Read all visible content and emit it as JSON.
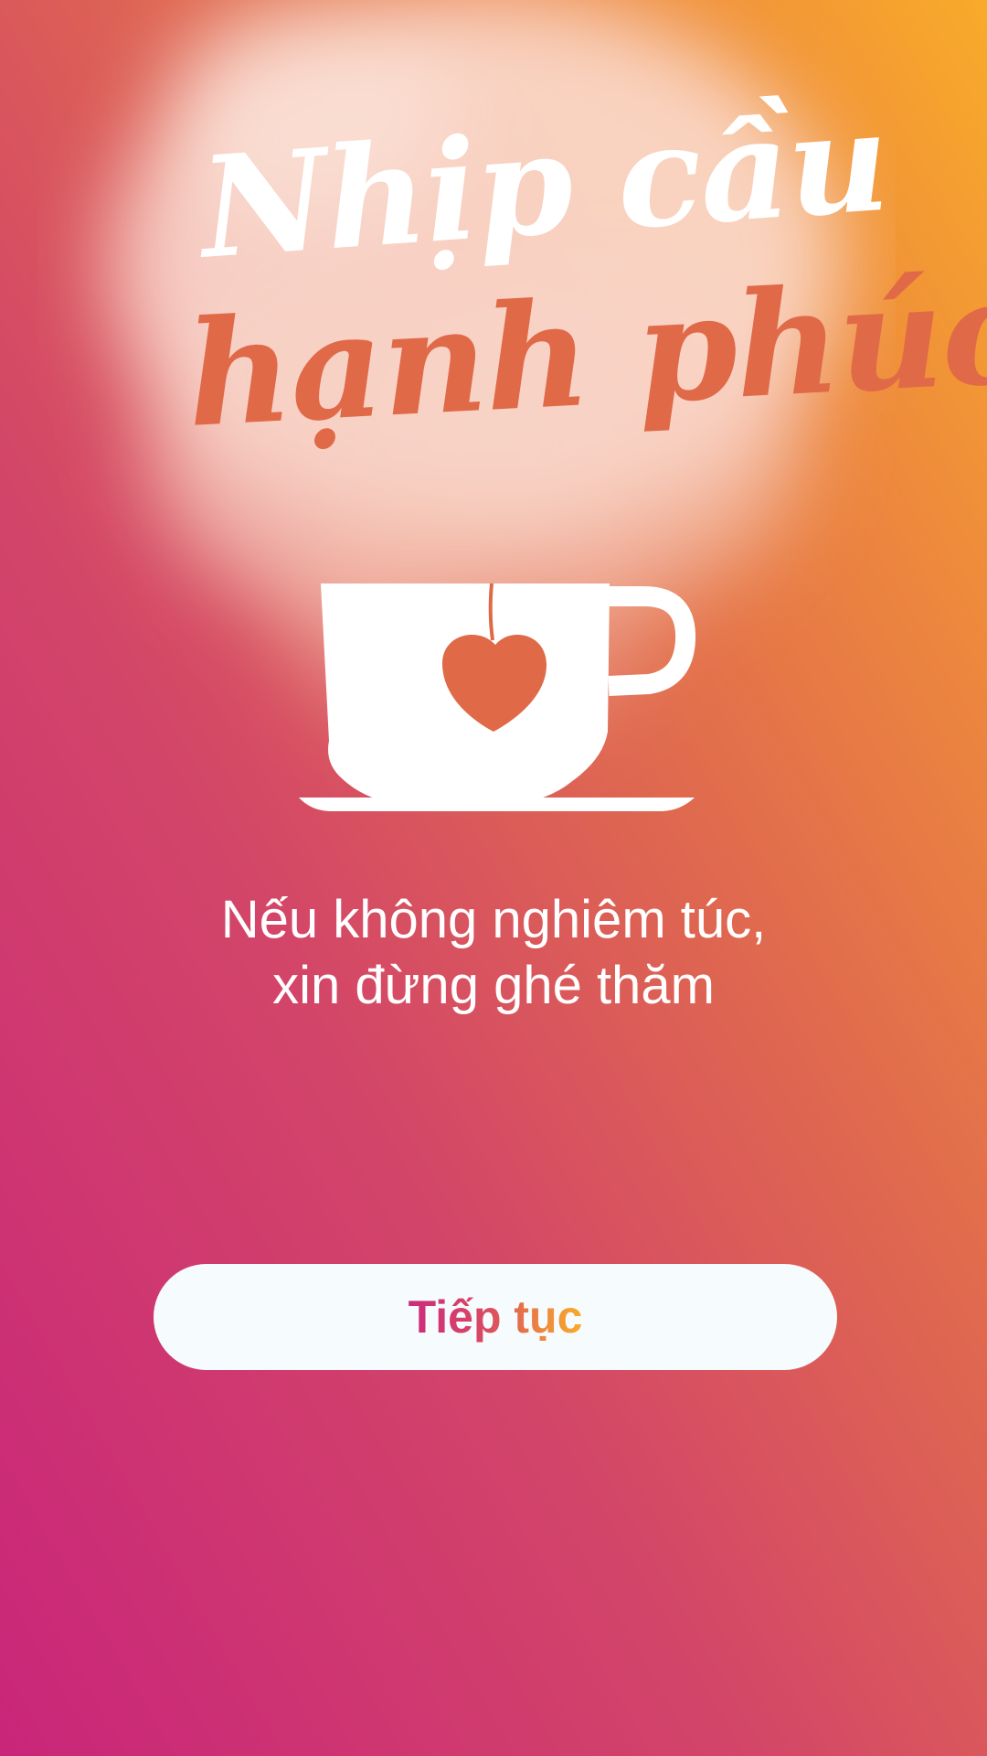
{
  "app": {
    "title_line_1": "Nhịp cầu",
    "title_line_2": "hạnh phúc",
    "logo_icon": "tea-cup-heart-icon"
  },
  "tagline": {
    "line_1": "Nếu không nghiêm túc,",
    "line_2": "xin đừng ghé thăm"
  },
  "actions": {
    "continue_label": "Tiếp tục"
  },
  "colors": {
    "background_start": "#c9257a",
    "background_end": "#f8ab2a",
    "title_accent": "#e06948",
    "button_bg": "#f6fbfd"
  }
}
